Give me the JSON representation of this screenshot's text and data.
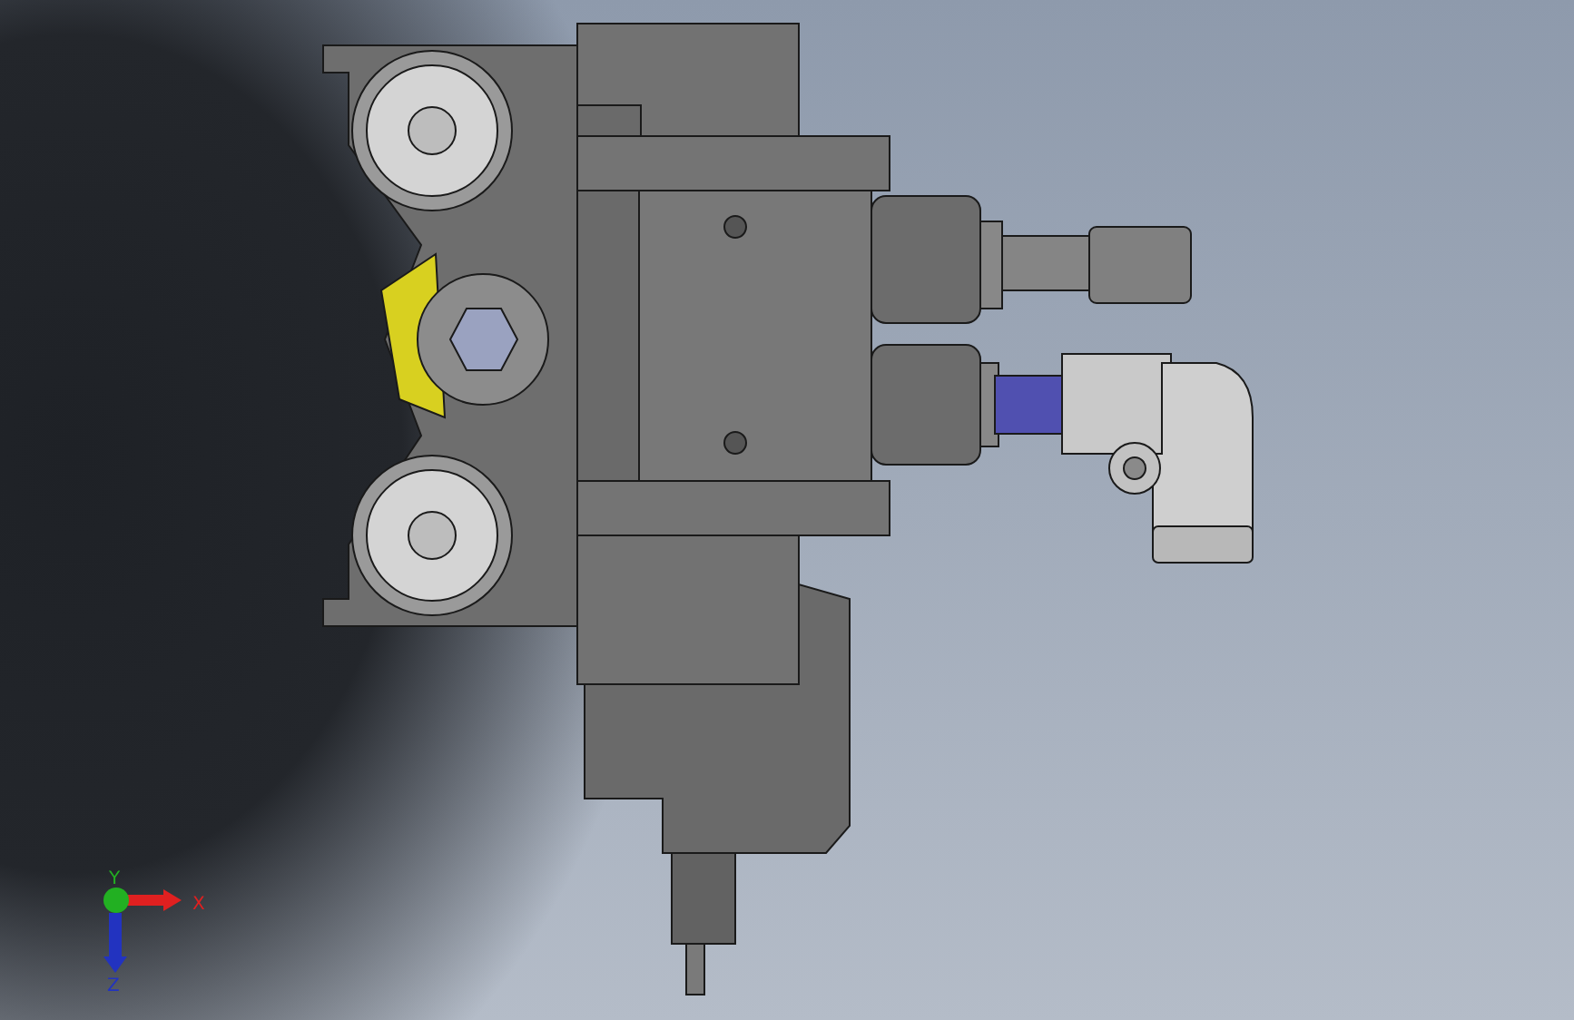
{
  "viewport": {
    "triad": {
      "axes": [
        {
          "label": "X",
          "kind": "x",
          "color": "#e02020"
        },
        {
          "label": "Y",
          "kind": "y",
          "color": "#22b022"
        },
        {
          "label": "Z",
          "kind": "z",
          "color": "#2233c0"
        }
      ]
    }
  }
}
